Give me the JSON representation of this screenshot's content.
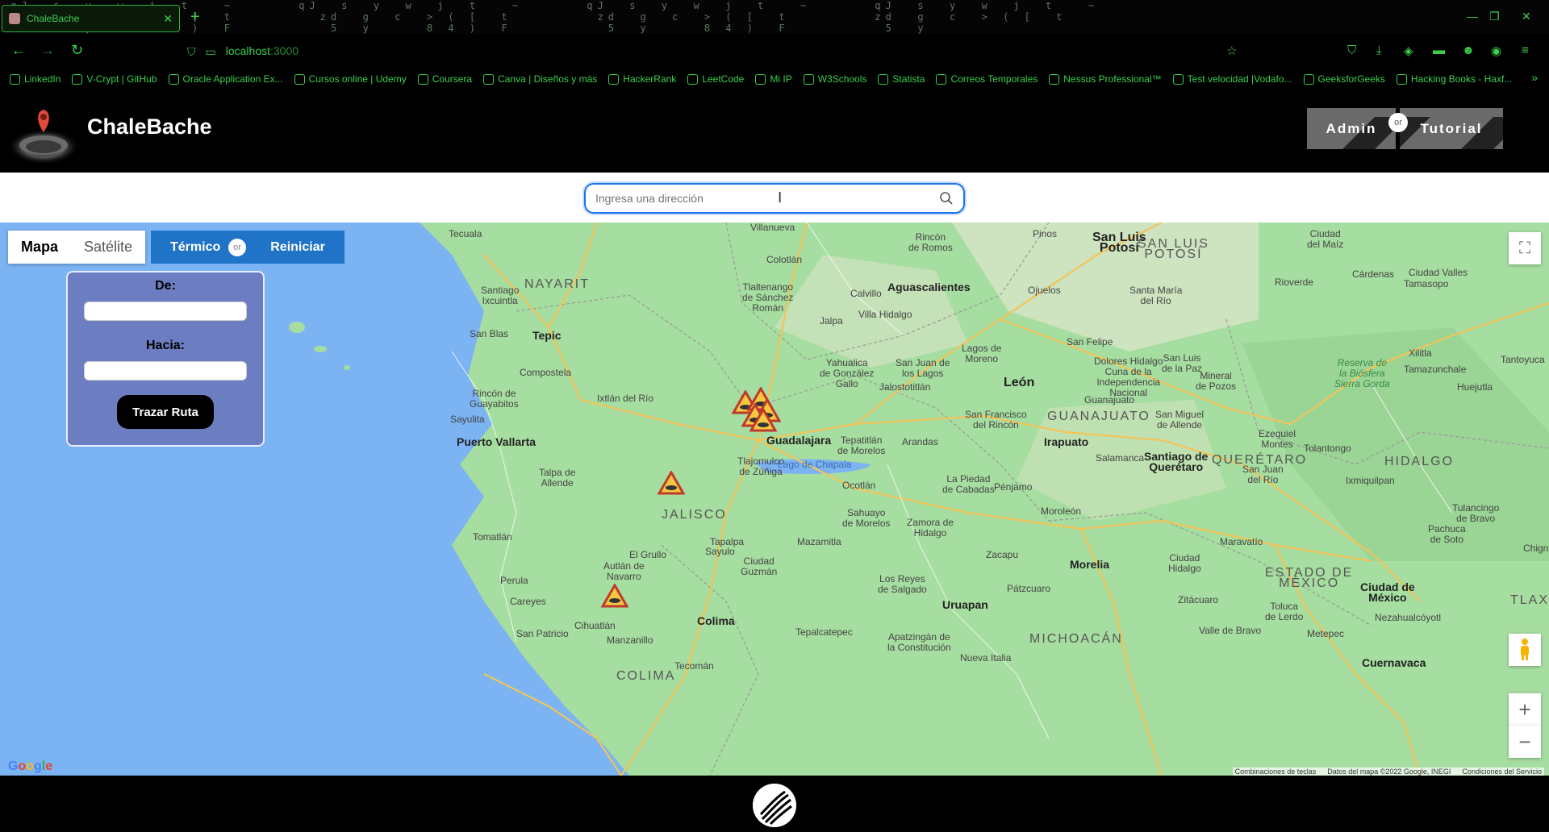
{
  "browser": {
    "tab_title": "ChaleBache",
    "url_host": "localhost",
    "url_port": ":3000",
    "matrix_text": " qJ  s  y  w  j  t   ~      qJ  s  y  w  j  t   ~      qJ  s  y  w  j  t   ~      qJ  s  y  w  j  t   ~\n    zd  g  c  > ( [  t        zd  g  c  > ( [  t        zd  g  c  > ( [  t        zd  g  c  > ( [  t \n     5  y     8 4 )  F         5  y     8 4 )  F         5  y     8 4 )  F         5  y"
  },
  "bookmarks": [
    {
      "label": "LinkedIn",
      "icon": "linkedin-icon"
    },
    {
      "label": "V-Crypt | GitHub",
      "icon": "github-icon"
    },
    {
      "label": "Oracle Application Ex...",
      "icon": "oracle-icon"
    },
    {
      "label": "Cursos online | Udemy",
      "icon": "udemy-icon"
    },
    {
      "label": "Coursera",
      "icon": "globe-icon"
    },
    {
      "label": "Canva | Diseños y más",
      "icon": "canva-icon"
    },
    {
      "label": "HackerRank",
      "icon": "globe-icon"
    },
    {
      "label": "LeetCode",
      "icon": "globe-icon"
    },
    {
      "label": "Mi IP",
      "icon": "globe-icon"
    },
    {
      "label": "W3Schools",
      "icon": "w3-icon"
    },
    {
      "label": "Statista",
      "icon": "statista-icon"
    },
    {
      "label": "Correos Temporales",
      "icon": "globe-icon"
    },
    {
      "label": "Nessus Professional™",
      "icon": "globe-icon"
    },
    {
      "label": "Test velocidad |Vodafo...",
      "icon": "vodafone-icon"
    },
    {
      "label": "GeeksforGeeks",
      "icon": "globe-icon"
    },
    {
      "label": "Hacking Books - Haxf...",
      "icon": "globe-icon"
    }
  ],
  "app": {
    "brand": "ChaleBache",
    "admin_label": "Admin",
    "or_label": "or",
    "tutorial_label": "Tutorial"
  },
  "search": {
    "placeholder": "Ingresa una dirección"
  },
  "map_controls": {
    "map_label": "Mapa",
    "satellite_label": "Satélite",
    "thermal_label": "Térmico",
    "or_label": "or",
    "reset_label": "Reiniciar"
  },
  "route": {
    "from_label": "De:",
    "to_label": "Hacia:",
    "button_label": "Trazar Ruta"
  },
  "map_labels": {
    "l1": "Villanueva",
    "l2": "Rincón\nde Romos",
    "l3": "Pinos",
    "l4": "San Luis\nPotosí",
    "l5": "SAN LUIS\nPOTOSÍ",
    "l6": "Ciudad\ndel Maíz",
    "l7": "Tecuala",
    "l8": "Colotlán",
    "l9": "NAYARIT",
    "l10": "Santiago\nIxcuintla",
    "l11": "Tlaltenango\nde Sánchez\nRomán",
    "l12": "Aguascalientes",
    "l13": "Ojuelos",
    "l14": "Santa María\ndel Río",
    "l15": "Rioverde",
    "l16": "Cárdenas",
    "l17": "Ciudad Valles",
    "l18": "Tamasopo",
    "l19": "Calvillo",
    "l20": "Villa Hidalgo",
    "l21": "Jalpa",
    "l22": "San Blas",
    "l23": "Tepic",
    "l24": "Lagos de\nMoreno",
    "l25": "San Felipe",
    "l26": "Dolores Hidalgo\nCuna de la\nIndependencia\nNacional",
    "l27": "San Luis\nde la Paz",
    "l28": "Mineral\nde Pozos",
    "l29": "Xilitla",
    "l30": "Compostela",
    "l31": "Yahualica\nde González\nGallo",
    "l32": "San Juan de\nlos Lagos",
    "l33": "Reserva de\nla Biósfera\nSierra Gorda",
    "l34": "Tamazunchale",
    "l35": "Tantoyuca",
    "l36": "Jalostotitlán",
    "l37": "León",
    "l38": "Rincón de\nGuayabitos",
    "l39": "Ixtlán del Río",
    "l40": "Guanajuato",
    "l41": "Huejutla",
    "l42": "Sayulita",
    "l43": "San Francisco\ndel Rincón",
    "l44": "GUANAJUATO",
    "l45": "San Miguel\nde Allende",
    "l46": "Puerto Vallarta",
    "l47": "Guadalajara",
    "l48": "Tepatitlán\nde Morelos",
    "l49": "Arandas",
    "l50": "Irapuato",
    "l51": "Ezequiel\nMontes",
    "l52": "Tlajomulco\nde Zúñiga",
    "l53": "Salamanca",
    "l54": "Santiago de\nQuerétaro",
    "l55": "QUERÉTARO",
    "l56": "Tolantongo",
    "l57": "HIDALGO",
    "l58": "Talpa de\nAllende",
    "l59": "La Piedad\nde Cabadas",
    "l60": "Pénjamo",
    "l61": "San Juan\ndel Río",
    "l62": "Ixmiquilpan",
    "l63": "Ocotlán",
    "l64": "Lago de Chapala",
    "l65": "JALISCO",
    "l66": "Sahuayo\nde Morelos",
    "l67": "Zamora de\nHidalgo",
    "l68": "Moroleón",
    "l69": "Tulancingo\nde Bravo",
    "l70": "Pachuca\nde Soto",
    "l71": "Tomatlán",
    "l72": "Maravatío",
    "l73": "Tapalpa",
    "l74": "Mazamitla",
    "l75": "Zacapu",
    "l76": "Morelia",
    "l77": "Ciudad\nHidalgo",
    "l78": "El Grullo",
    "l79": "Sayulo",
    "l80": "Ciudad\nGuzmán",
    "l81": "ESTADO DE\nMÉXICO",
    "l82": "Autlán de\nNavarro",
    "l83": "Los Reyes\nde Salgado",
    "l84": "Pátzcuaro",
    "l85": "Perula",
    "l86": "Ciudad de\nMéxico",
    "l87": "Careyes",
    "l88": "Uruapan",
    "l89": "Zitácuaro",
    "l90": "Toluca\nde Lerdo",
    "l91": "Colima",
    "l92": "Nezahualcóyotl",
    "l93": "Cihuatlán",
    "l94": "San Patricio",
    "l95": "Manzanillo",
    "l96": "Tepalcatepec",
    "l97": "Apatzingán de\nla Constitución",
    "l98": "MICHOACÁN",
    "l99": "Valle de Bravo",
    "l100": "Metepec",
    "l101": "Tecomán",
    "l102": "Nueva Italia",
    "l103": "Cuernavaca",
    "l104": "TLAXCA",
    "l105": "Chign",
    "l106": "COLIMA"
  },
  "attribution": {
    "google": "Google",
    "keys": "Combinaciones de teclas",
    "data": "Datos del mapa ©2022 Google, INEGI",
    "terms": "Condiciones del Servicio"
  },
  "colors": {
    "accent_green": "#3ccf4e",
    "map_land": "#a6dda0",
    "map_water": "#7cb3f3",
    "button_blue": "#1f74c8",
    "panel_blue": "#6c7ec1"
  }
}
